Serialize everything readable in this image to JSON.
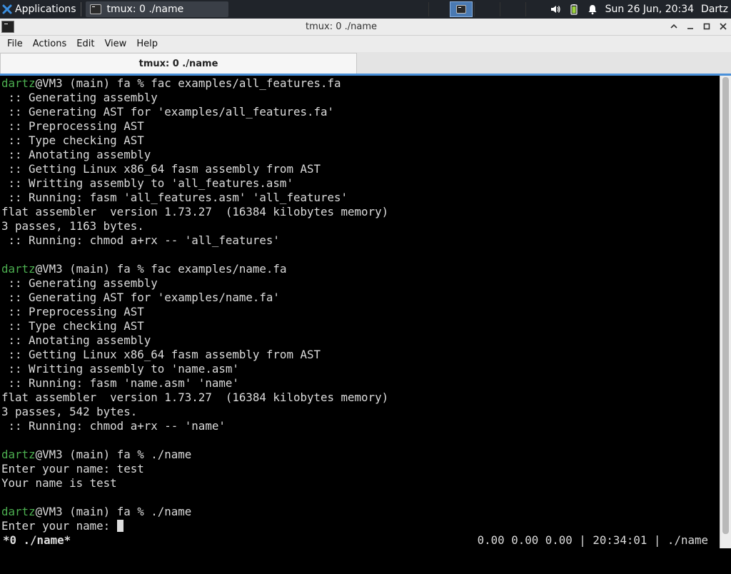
{
  "panel": {
    "apps_label": "Applications",
    "task_label": "tmux: 0 ./name",
    "clock": "Sun 26 Jun, 20:34",
    "user": "Dartz",
    "icons": [
      "xfce-logo-icon",
      "terminal-icon",
      "volume-icon",
      "battery-icon",
      "notification-bell-icon"
    ]
  },
  "window": {
    "title": "tmux: 0 ./name",
    "controls": [
      "minimize-up",
      "minimize",
      "maximize",
      "close"
    ]
  },
  "menu": {
    "items": [
      "File",
      "Actions",
      "Edit",
      "View",
      "Help"
    ]
  },
  "tabs": [
    {
      "label": "tmux: 0 ./name",
      "active": true
    }
  ],
  "terminal": {
    "lines": [
      {
        "user": "dartz",
        "text": "@VM3 (main) fa % fac examples/all_features.fa"
      },
      {
        "text": " :: Generating assembly"
      },
      {
        "text": " :: Generating AST for 'examples/all_features.fa'"
      },
      {
        "text": " :: Preprocessing AST"
      },
      {
        "text": " :: Type checking AST"
      },
      {
        "text": " :: Anotating assembly"
      },
      {
        "text": " :: Getting Linux x86_64 fasm assembly from AST"
      },
      {
        "text": " :: Writting assembly to 'all_features.asm'"
      },
      {
        "text": " :: Running: fasm 'all_features.asm' 'all_features'"
      },
      {
        "text": "flat assembler  version 1.73.27  (16384 kilobytes memory)"
      },
      {
        "text": "3 passes, 1163 bytes."
      },
      {
        "text": " :: Running: chmod a+rx -- 'all_features'"
      },
      {
        "text": ""
      },
      {
        "user": "dartz",
        "text": "@VM3 (main) fa % fac examples/name.fa"
      },
      {
        "text": " :: Generating assembly"
      },
      {
        "text": " :: Generating AST for 'examples/name.fa'"
      },
      {
        "text": " :: Preprocessing AST"
      },
      {
        "text": " :: Type checking AST"
      },
      {
        "text": " :: Anotating assembly"
      },
      {
        "text": " :: Getting Linux x86_64 fasm assembly from AST"
      },
      {
        "text": " :: Writting assembly to 'name.asm'"
      },
      {
        "text": " :: Running: fasm 'name.asm' 'name'"
      },
      {
        "text": "flat assembler  version 1.73.27  (16384 kilobytes memory)"
      },
      {
        "text": "3 passes, 542 bytes."
      },
      {
        "text": " :: Running: chmod a+rx -- 'name'"
      },
      {
        "text": ""
      },
      {
        "user": "dartz",
        "text": "@VM3 (main) fa % ./name"
      },
      {
        "text": "Enter your name: test"
      },
      {
        "text": "Your name is test"
      },
      {
        "text": ""
      },
      {
        "user": "dartz",
        "text": "@VM3 (main) fa % ./name"
      },
      {
        "text": "Enter your name: ",
        "cursor": true
      }
    ]
  },
  "tmux_status": {
    "left": "*0 ./name*",
    "right": "0.00 0.00 0.00 | 20:34:01 | ./name"
  },
  "colors": {
    "prompt_user": "#4caf50",
    "panel_bg": "#20242a",
    "workspace_active": "#4a7ab3",
    "tab_underline": "#4a90d9"
  }
}
